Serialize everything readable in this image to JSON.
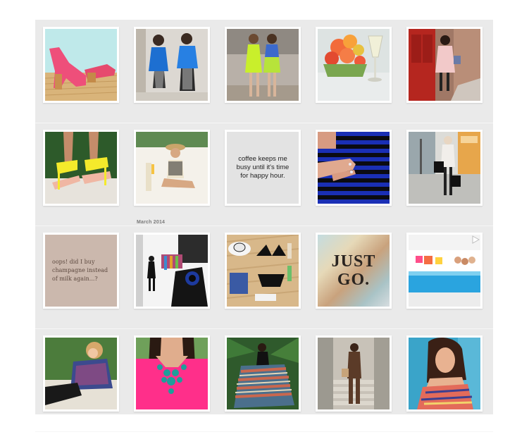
{
  "gallery": {
    "section_label": "March 2014",
    "quotes": {
      "coffee": "coffee keeps me busy until it's time for happy hour.",
      "oops": "oops! did I buy champagne instead of milk again...?",
      "just": "JUST",
      "go": "GO."
    },
    "icons": {
      "video": "play-triangle-icon"
    }
  }
}
